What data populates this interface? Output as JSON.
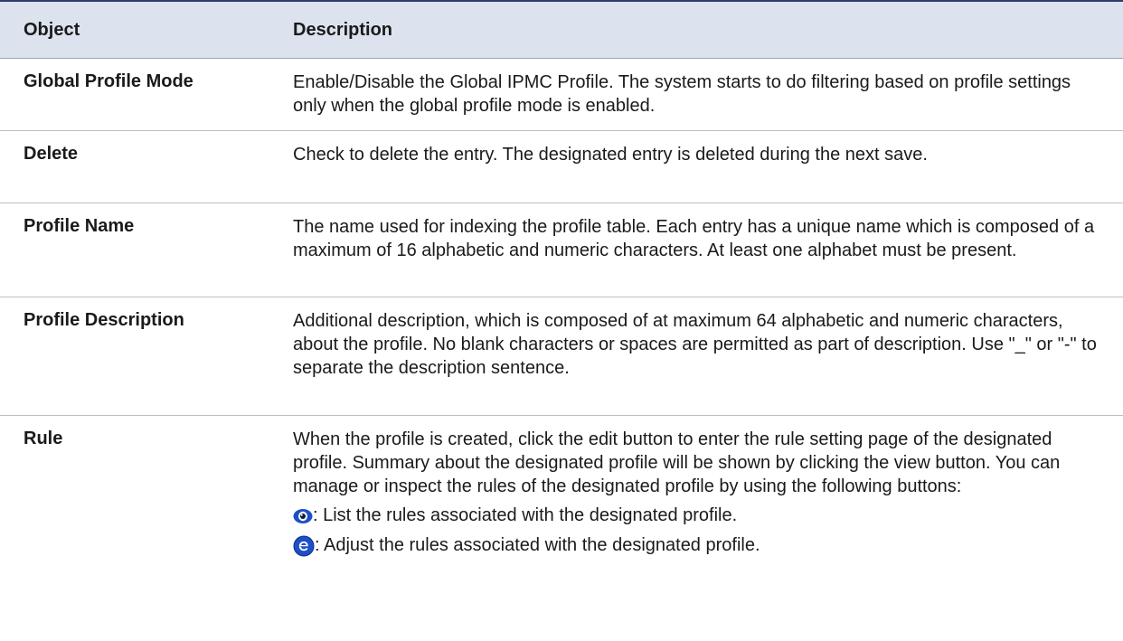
{
  "table": {
    "headers": {
      "object": "Object",
      "description": "Description"
    },
    "rows": [
      {
        "object": "Global Profile Mode",
        "description": "Enable/Disable the Global IPMC Profile. The system starts to do filtering based on profile settings only when the global profile mode is enabled."
      },
      {
        "object": "Delete",
        "description": "Check to delete the entry. The designated entry is deleted during the next save."
      },
      {
        "object": "Profile Name",
        "description": "The name used for indexing the profile table. Each entry has a unique name which is composed of a maximum of 16 alphabetic and numeric characters. At least one alphabet must be present."
      },
      {
        "object": "Profile Description",
        "description": "Additional description, which is composed of at maximum 64 alphabetic and numeric characters, about the profile. No blank characters or spaces are permitted as part of description. Use \"_\" or \"-\" to separate the description sentence."
      },
      {
        "object": "Rule",
        "description": "When the profile is created, click the edit button to enter the rule setting page of the designated profile. Summary about the designated profile will be shown by clicking the view button. You can manage or inspect the rules of the designated profile by using the following buttons:",
        "buttons": [
          {
            "icon": "view-eye-icon",
            "text": ": List the rules associated with the designated profile."
          },
          {
            "icon": "edit-e-icon",
            "text": ": Adjust the rules associated with the designated profile."
          }
        ]
      }
    ]
  },
  "colors": {
    "header_bg": "#dde3ee",
    "header_border": "#2c3e6b",
    "row_border": "#b9bec8",
    "icon_blue": "#1d4fc7"
  }
}
